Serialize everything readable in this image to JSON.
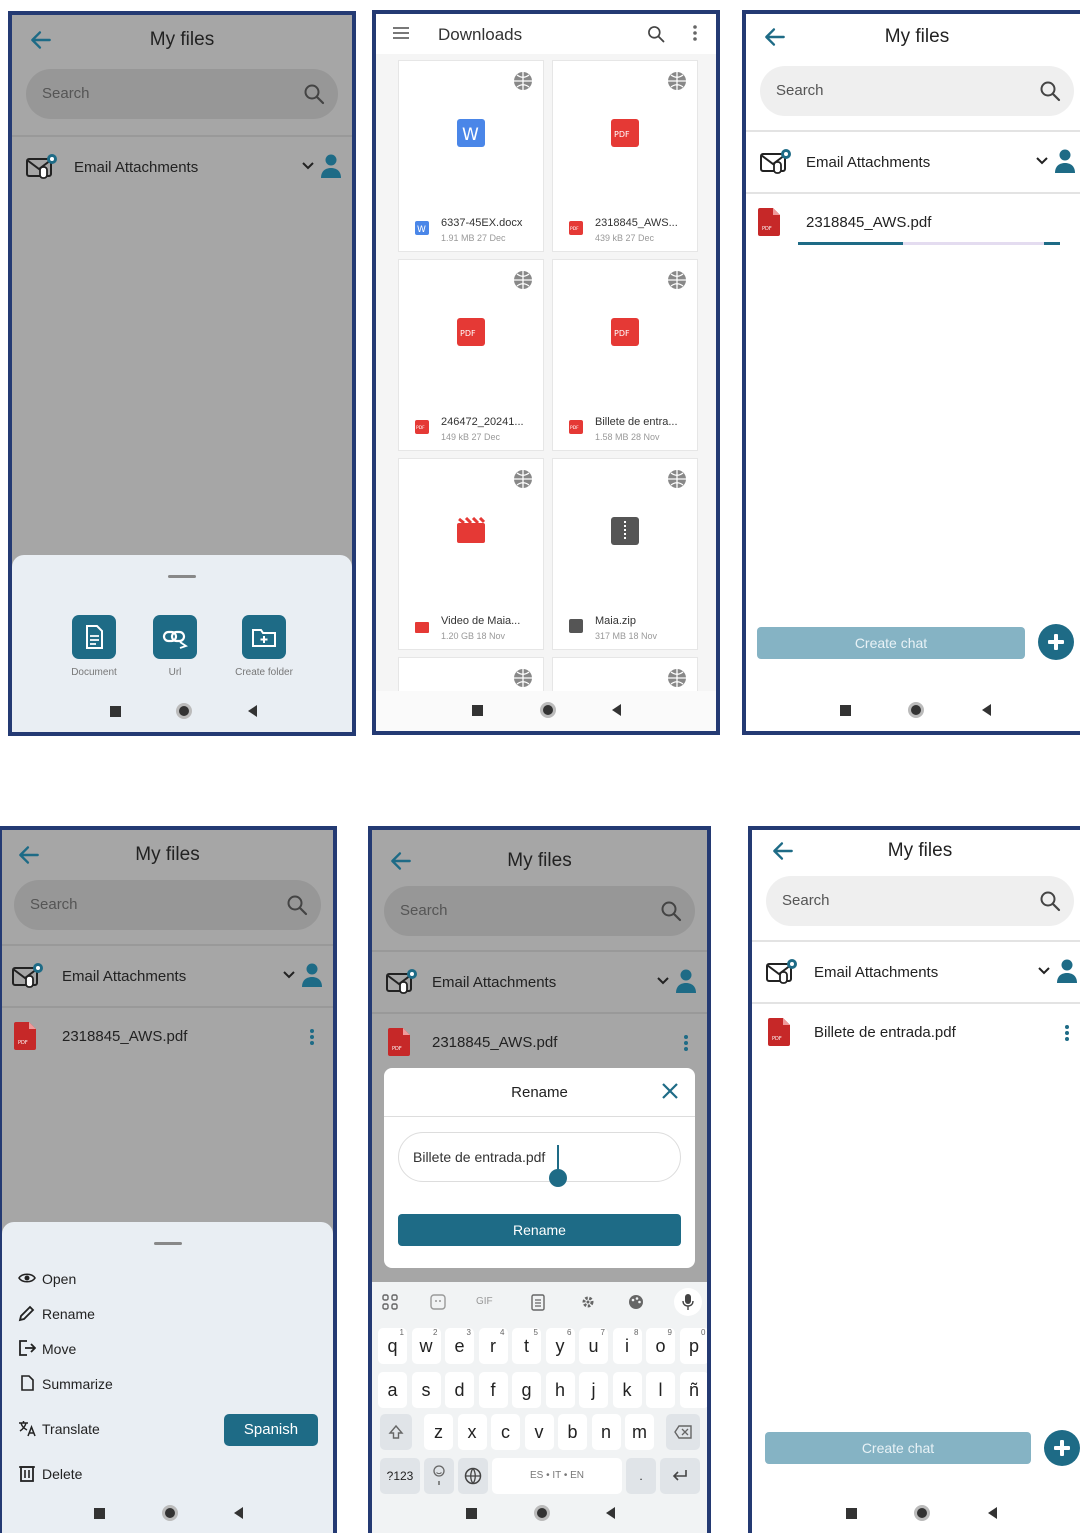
{
  "app": {
    "title": "My files",
    "search_placeholder": "Search",
    "folder_label": "Email Attachments"
  },
  "screen1": {
    "actions": [
      {
        "label": "Document",
        "icon": "document-icon"
      },
      {
        "label": "Url",
        "icon": "link-icon"
      },
      {
        "label": "Create folder",
        "icon": "new-folder-icon"
      }
    ]
  },
  "screen2": {
    "title": "Downloads",
    "files": [
      {
        "name": "6337-45EX.docx",
        "meta": "1.91 MB 27 Dec",
        "type": "word"
      },
      {
        "name": "2318845_AWS...",
        "meta": "439 kB 27 Dec",
        "type": "pdf"
      },
      {
        "name": "246472_20241...",
        "meta": "149 kB 27 Dec",
        "type": "pdf"
      },
      {
        "name": "Billete de entra...",
        "meta": "1.58 MB 28 Nov",
        "type": "pdf"
      },
      {
        "name": "Video de Maia...",
        "meta": "1.20 GB 18 Nov",
        "type": "video"
      },
      {
        "name": "Maia.zip",
        "meta": "317 MB 18 Nov",
        "type": "zip"
      }
    ]
  },
  "screen3": {
    "uploading_file": "2318845_AWS.pdf",
    "upload_progress": 0.4,
    "create_chat": "Create chat"
  },
  "screen4": {
    "file": "2318845_AWS.pdf",
    "menu": [
      {
        "label": "Open",
        "icon": "eye-icon"
      },
      {
        "label": "Rename",
        "icon": "pencil-icon"
      },
      {
        "label": "Move",
        "icon": "move-icon"
      },
      {
        "label": "Summarize",
        "icon": "summarize-icon"
      },
      {
        "label": "Translate",
        "icon": "translate-icon"
      },
      {
        "label": "Delete",
        "icon": "trash-icon"
      }
    ],
    "translate_language": "Spanish"
  },
  "screen5": {
    "file": "2318845_AWS.pdf",
    "dialog_title": "Rename",
    "input_value": "Billete de entrada.pdf",
    "rename_button": "Rename",
    "keyboard": {
      "row1": [
        "q",
        "w",
        "e",
        "r",
        "t",
        "y",
        "u",
        "i",
        "o",
        "p"
      ],
      "row1_hints": [
        "1",
        "2",
        "3",
        "4",
        "5",
        "6",
        "7",
        "8",
        "9",
        "0"
      ],
      "row2": [
        "a",
        "s",
        "d",
        "f",
        "g",
        "h",
        "j",
        "k",
        "l",
        "ñ"
      ],
      "row3": [
        "z",
        "x",
        "c",
        "v",
        "b",
        "n",
        "m"
      ],
      "symbols_key": "?123",
      "space_label": "ES • IT • EN",
      "period_key": ".",
      "gif_label": "GIF"
    }
  },
  "screen6": {
    "file": "Billete de entrada.pdf",
    "create_chat": "Create chat"
  },
  "colors": {
    "accent": "#1e6b86",
    "frame": "#243a73",
    "pdf_red": "#d32f2f",
    "word_blue": "#4a86e8"
  }
}
